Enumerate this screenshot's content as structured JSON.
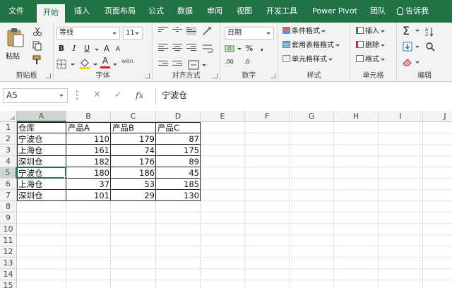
{
  "tabs": [
    {
      "label": "文件",
      "active": false
    },
    {
      "label": "开始",
      "active": true
    },
    {
      "label": "插入",
      "active": false
    },
    {
      "label": "页面布局",
      "active": false
    },
    {
      "label": "公式",
      "active": false
    },
    {
      "label": "数据",
      "active": false
    },
    {
      "label": "审阅",
      "active": false
    },
    {
      "label": "视图",
      "active": false
    },
    {
      "label": "开发工具",
      "active": false
    },
    {
      "label": "Power Pivot",
      "active": false
    },
    {
      "label": "团队",
      "active": false
    }
  ],
  "tell_me": "告诉我",
  "ribbon": {
    "clipboard": {
      "label": "剪贴板",
      "paste": "粘贴"
    },
    "font": {
      "label": "字体",
      "name": "等线",
      "size": "11",
      "bold": "B",
      "italic": "I",
      "underline": "U",
      "grow": "A",
      "shrink": "A",
      "font_color": "A",
      "wen": "wén"
    },
    "alignment": {
      "label": "对齐方式"
    },
    "number": {
      "label": "数字",
      "format": "日期",
      "percent": "%",
      "comma": ",",
      "increase": ".00",
      "decrease": ".0"
    },
    "styles": {
      "label": "样式",
      "conditional": "条件格式",
      "table": "套用表格格式",
      "cell": "单元格样式"
    },
    "cells": {
      "label": "单元格",
      "insert": "插入",
      "delete": "删除",
      "format": "格式"
    },
    "editing": {
      "label": "编辑",
      "sum": "Σ"
    }
  },
  "formula_bar": {
    "name_box": "A5",
    "cancel": "✕",
    "enter": "✓",
    "fx": "fx",
    "value": "宁波仓"
  },
  "columns": [
    "A",
    "B",
    "C",
    "D",
    "E",
    "F",
    "G",
    "H",
    "I",
    "J"
  ],
  "selected_column": "A",
  "selected_row": 5,
  "rows": [
    {
      "n": 1,
      "cells": [
        "仓库",
        "产品A",
        "产品B",
        "产品C"
      ]
    },
    {
      "n": 2,
      "cells": [
        "宁波仓",
        "110",
        "179",
        "87"
      ]
    },
    {
      "n": 3,
      "cells": [
        "上海仓",
        "161",
        "74",
        "175"
      ]
    },
    {
      "n": 4,
      "cells": [
        "深圳仓",
        "182",
        "176",
        "89"
      ]
    },
    {
      "n": 5,
      "cells": [
        "宁波仓",
        "180",
        "186",
        "45"
      ]
    },
    {
      "n": 6,
      "cells": [
        "上海仓",
        "37",
        "53",
        "185"
      ]
    },
    {
      "n": 7,
      "cells": [
        "深圳仓",
        "101",
        "29",
        "130"
      ]
    },
    {
      "n": 8,
      "cells": []
    },
    {
      "n": 9,
      "cells": []
    },
    {
      "n": 10,
      "cells": []
    },
    {
      "n": 11,
      "cells": []
    },
    {
      "n": 12,
      "cells": []
    },
    {
      "n": 13,
      "cells": []
    },
    {
      "n": 14,
      "cells": []
    },
    {
      "n": 15,
      "cells": []
    }
  ],
  "colors": {
    "accent": "#217346",
    "ribbon_bg": "#f3f3f3",
    "font_color_bar": "#e02020",
    "fill_color_bar": "#ffd400"
  }
}
